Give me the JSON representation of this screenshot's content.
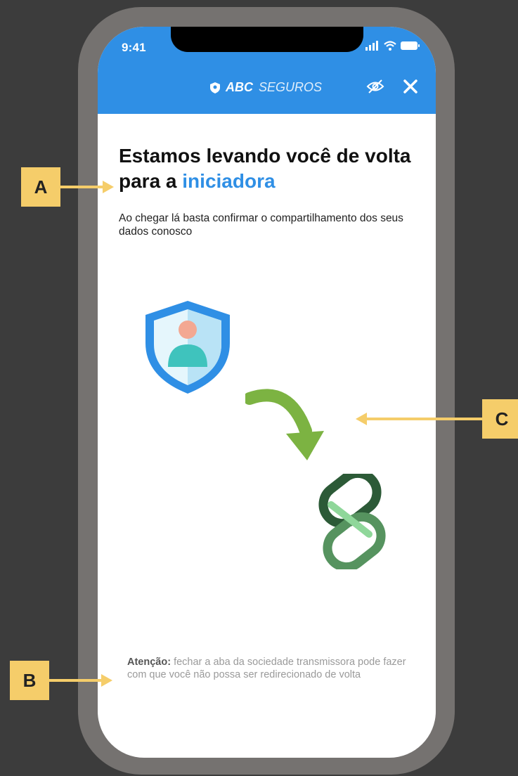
{
  "status_bar": {
    "time": "9:41"
  },
  "header": {
    "brand_bold": "ABC",
    "brand_light": "SEGUROS"
  },
  "content": {
    "title_part1": "Estamos levando você de volta para a ",
    "title_accent": "iniciadora",
    "subtitle": "Ao chegar lá basta confirmar o compartilhamento dos seus dados conosco",
    "note_bold": "Atenção:",
    "note_text": " fechar a aba da sociedade transmissora pode fazer com que você não possa ser redirecionado de volta"
  },
  "callouts": {
    "a": "A",
    "b": "B",
    "c": "C"
  },
  "colors": {
    "accent": "#2f8fe5",
    "callout": "#f5cd6a",
    "arrow": "#7cb342"
  },
  "icons": [
    "shield-user-icon",
    "arrow-down-curve-icon",
    "link-logo-icon",
    "eye-off-icon",
    "close-icon",
    "signal-icon",
    "wifi-icon",
    "battery-icon"
  ]
}
